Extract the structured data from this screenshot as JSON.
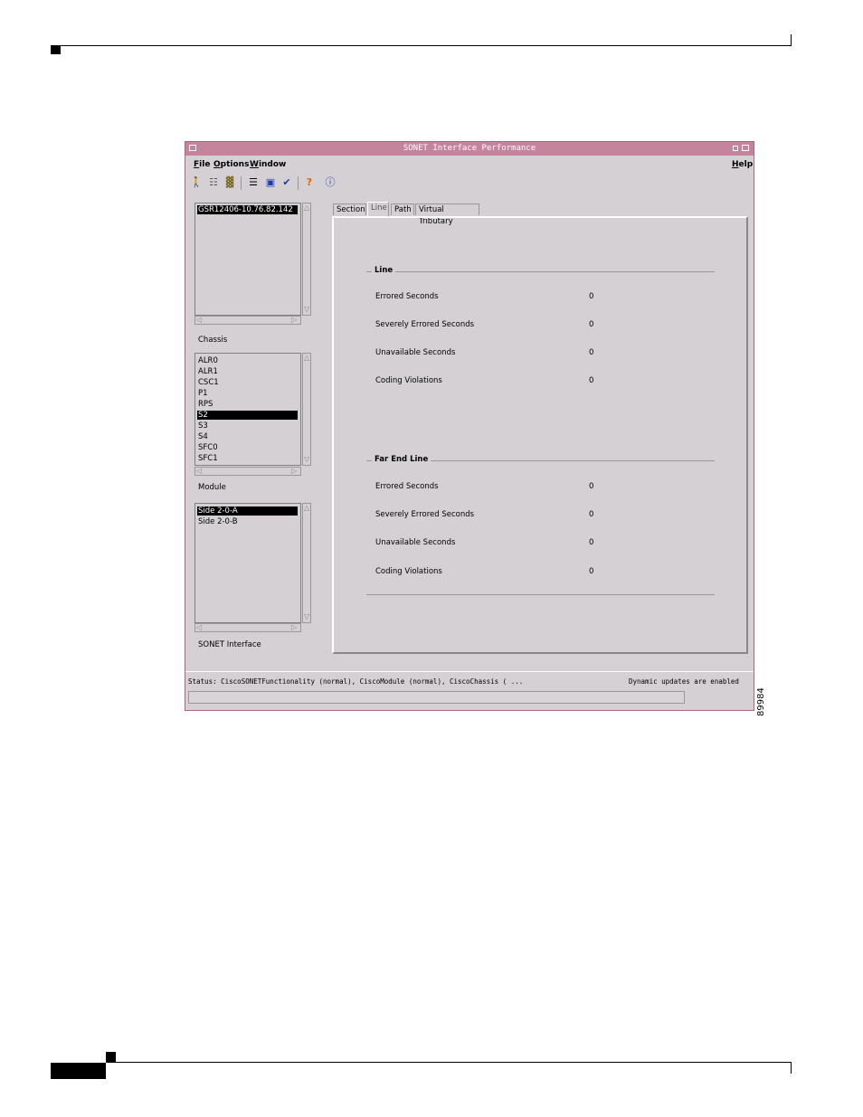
{
  "figure_number": "89984",
  "window": {
    "title": "SONET Interface Performance"
  },
  "menubar": {
    "file": "File",
    "options": "Options",
    "window": "Window",
    "help": "Help"
  },
  "toolbar": {
    "icons": [
      "exit-icon",
      "inventory-icon",
      "chassis-icon",
      "list-icon",
      "monitor-icon",
      "checkmark-icon",
      "help-icon",
      "info-icon"
    ]
  },
  "device_list": {
    "items": [
      "GSR12406-10.76.82.142"
    ],
    "selected": "GSR12406-10.76.82.142",
    "label": "Chassis"
  },
  "module_list": {
    "items": [
      "ALR0",
      "ALR1",
      "CSC1",
      "P1",
      "RPS",
      "S2",
      "S3",
      "S4",
      "SFC0",
      "SFC1"
    ],
    "selected": "S2",
    "label": "Module"
  },
  "interface_list": {
    "items": [
      "Side 2-0-A",
      "Side 2-0-B"
    ],
    "selected": "Side 2-0-A",
    "label": "SONET Interface"
  },
  "tabs": [
    {
      "label": "Section",
      "active": false
    },
    {
      "label": "Line",
      "active": true
    },
    {
      "label": "Path",
      "active": false
    },
    {
      "label": "Virtual Tributary",
      "active": false
    }
  ],
  "line_group": {
    "title": "Line",
    "metrics": [
      {
        "label": "Errored Seconds",
        "value": "0"
      },
      {
        "label": "Severely Errored Seconds",
        "value": "0"
      },
      {
        "label": "Unavailable Seconds",
        "value": "0"
      },
      {
        "label": "Coding Violations",
        "value": "0"
      }
    ]
  },
  "far_end_group": {
    "title": "Far End Line",
    "metrics": [
      {
        "label": "Errored Seconds",
        "value": "0"
      },
      {
        "label": "Severely Errored Seconds",
        "value": "0"
      },
      {
        "label": "Unavailable Seconds",
        "value": "0"
      },
      {
        "label": "Coding Violations",
        "value": "0"
      }
    ]
  },
  "status": {
    "text": "Status: CiscoSONETFunctionality (normal), CiscoModule (normal), CiscoChassis ( ...",
    "updates": "Dynamic updates are enabled"
  },
  "colors": {
    "titlebar": "#c4849c",
    "window_bg": "#d4d0d4",
    "selection": "#000000"
  }
}
